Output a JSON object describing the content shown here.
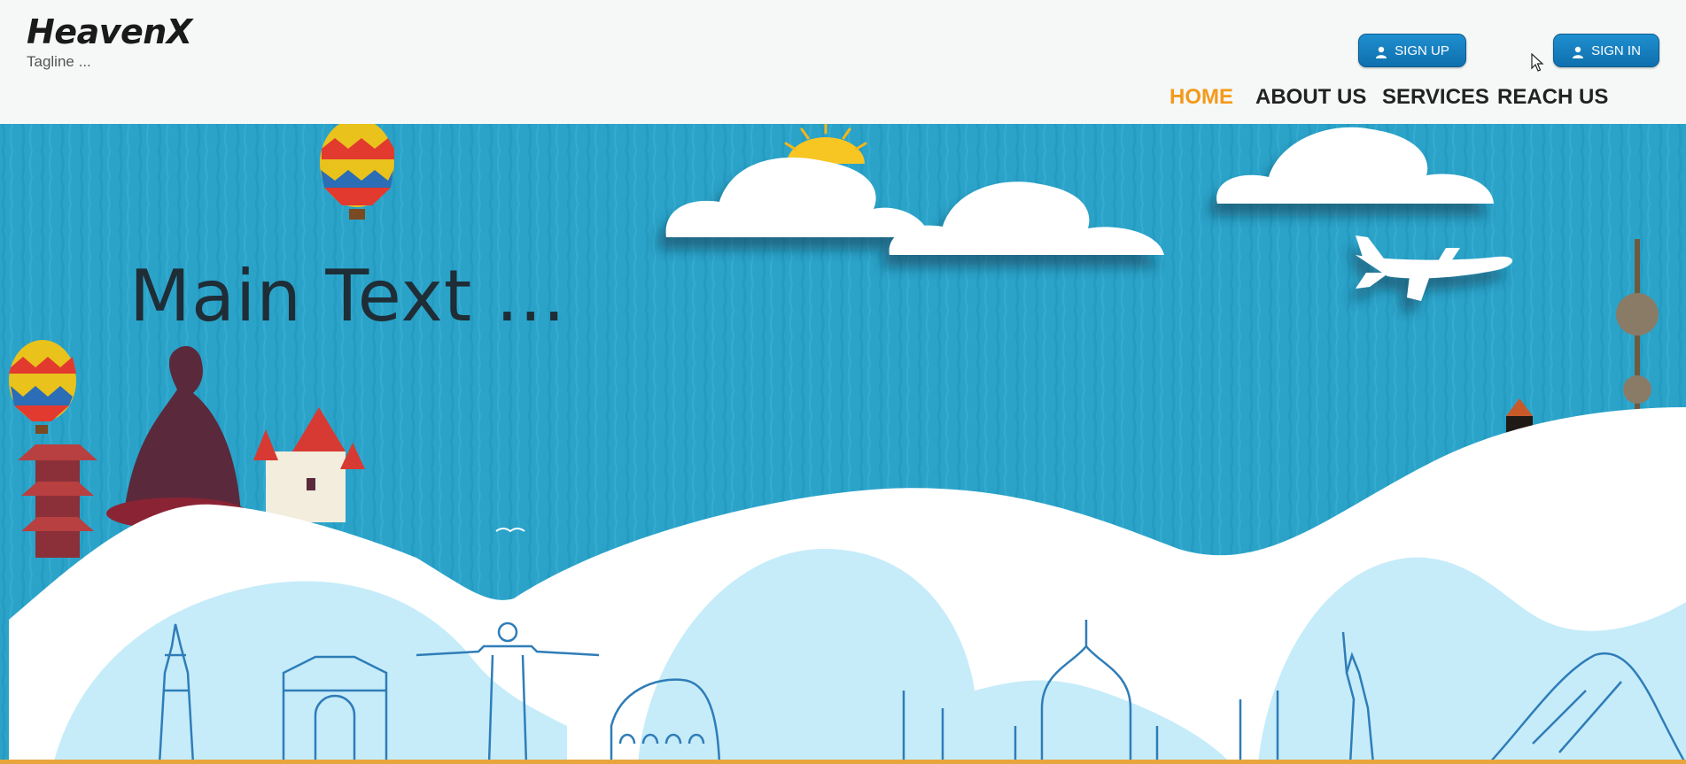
{
  "brand": {
    "name": "HeavenX",
    "tagline": "Tagline ..."
  },
  "auth": {
    "signup_label": "SIGN UP",
    "signin_label": "SIGN IN"
  },
  "nav": {
    "items": [
      {
        "label": "HOME",
        "active": true
      },
      {
        "label": "ABOUT US",
        "active": false
      },
      {
        "label": "SERVICES",
        "active": false
      },
      {
        "label": "REACH US",
        "active": false
      }
    ]
  },
  "hero": {
    "main_text": "Main Text ..."
  },
  "colors": {
    "accent": "#f39a1b",
    "button": "#1a86c6",
    "sky": "#2ba3c9",
    "hill": "#c6ecfa",
    "line_art": "#2f7db8",
    "bottom_bar": "#e8a53c"
  }
}
